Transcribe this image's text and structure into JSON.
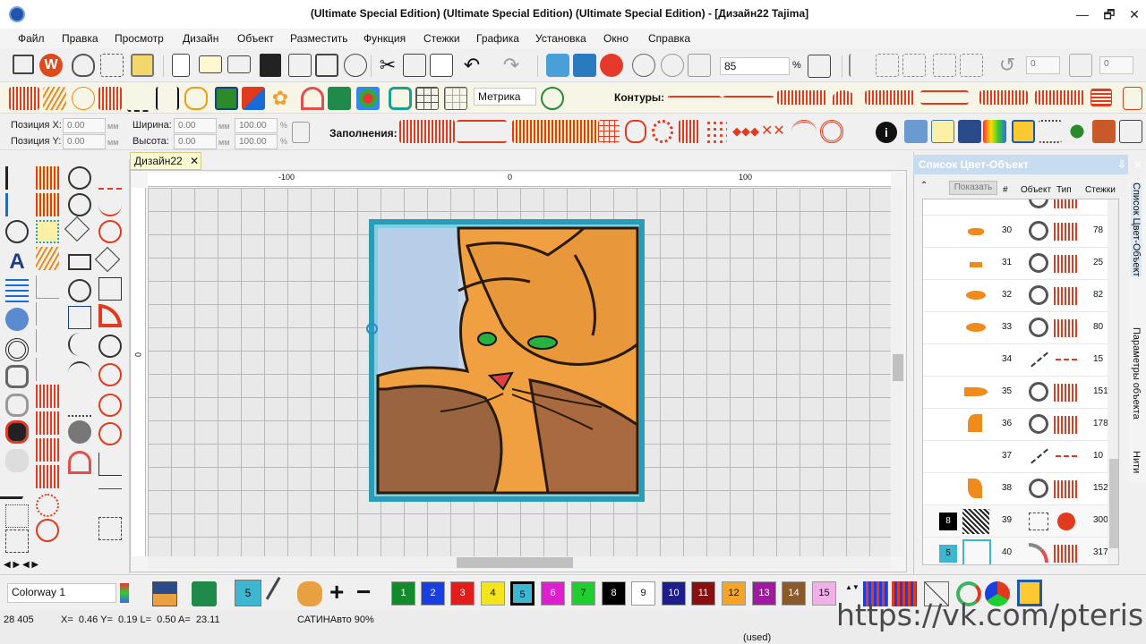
{
  "window": {
    "title": "(Ultimate Special Edition) (Ultimate Special Edition) (Ultimate Special Edition) - [Дизайн22       Tajima]",
    "minimize": "—",
    "restore": "🗗",
    "close": "✕"
  },
  "menu": [
    "Файл",
    "Правка",
    "Просмотр",
    "Дизайн",
    "Объект",
    "Разместить",
    "Функция",
    "Стежки",
    "Графика",
    "Установка",
    "Окно",
    "Справка"
  ],
  "toolbar1": {
    "zoom_value": "85",
    "zoom_unit": "%",
    "undo_count": "0",
    "redo_count": "0"
  },
  "toolbar2": {
    "units_select": "Метрика",
    "contours_label": "Контуры:"
  },
  "properties": {
    "pos_x_label": "Позиция X:",
    "pos_x_value": "0.00",
    "pos_y_label": "Позиция Y:",
    "pos_y_value": "0.00",
    "width_label": "Ширина:",
    "width_value": "0.00",
    "height_label": "Высота:",
    "height_value": "0.00",
    "unit": "мм",
    "width_pct": "100.00",
    "height_pct": "100.00",
    "pct": "%",
    "fills_label": "Заполнения:"
  },
  "document": {
    "tab_label": "Дизайн22",
    "tab_close": "✕"
  },
  "ruler": {
    "h_labels": [
      "-100",
      "0",
      "100"
    ],
    "v_label": "0"
  },
  "right_panel": {
    "header": "Список Цвет-Объект",
    "pin": "⇩",
    "close": "✕",
    "show_button": "Показать",
    "columns": {
      "num": "#",
      "object": "Объект",
      "type": "Тип",
      "stitches": "Стежки"
    },
    "rows": [
      {
        "num": "",
        "stitches": ""
      },
      {
        "num": "30",
        "stitches": "78"
      },
      {
        "num": "31",
        "stitches": "25"
      },
      {
        "num": "32",
        "stitches": "82"
      },
      {
        "num": "33",
        "stitches": "80"
      },
      {
        "num": "34",
        "stitches": "15"
      },
      {
        "num": "35",
        "stitches": "151"
      },
      {
        "num": "36",
        "stitches": "178"
      },
      {
        "num": "37",
        "stitches": "10"
      },
      {
        "num": "38",
        "stitches": "152"
      },
      {
        "num": "39",
        "stitches": "300",
        "color_badge": "8"
      },
      {
        "num": "40",
        "stitches": "317",
        "color_badge": "5"
      }
    ],
    "vertical_tabs": [
      "Список Цвет-Объект",
      "Параметры объекта",
      "Нити"
    ]
  },
  "bottom": {
    "colorway": "Colorway 1",
    "current_color": "5",
    "swatches": [
      {
        "label": "1",
        "color": "#138a2c"
      },
      {
        "label": "2",
        "color": "#1a3fe0"
      },
      {
        "label": "3",
        "color": "#e21b1b"
      },
      {
        "label": "4",
        "color": "#f2e51e"
      },
      {
        "label": "5",
        "color": "#3fb6d0"
      },
      {
        "label": "6",
        "color": "#dd1fd0"
      },
      {
        "label": "7",
        "color": "#1fcf2f"
      },
      {
        "label": "8",
        "color": "#000000"
      },
      {
        "label": "9",
        "color": "#ffffff"
      },
      {
        "label": "10",
        "color": "#1e1e8a"
      },
      {
        "label": "11",
        "color": "#8a1010"
      },
      {
        "label": "12",
        "color": "#f3a52a"
      },
      {
        "label": "13",
        "color": "#a01aa0"
      },
      {
        "label": "14",
        "color": "#8a5a2a"
      },
      {
        "label": "15",
        "color": "#f0b0e8"
      }
    ]
  },
  "status": {
    "stitch_count": "28 405",
    "coords": "X=  0.46 Y=  0.19 L=  0.50 A=  23.11",
    "mode": "САТИНАвто 90%",
    "used": "(used)"
  },
  "watermark": "https://vk.com/pteris"
}
